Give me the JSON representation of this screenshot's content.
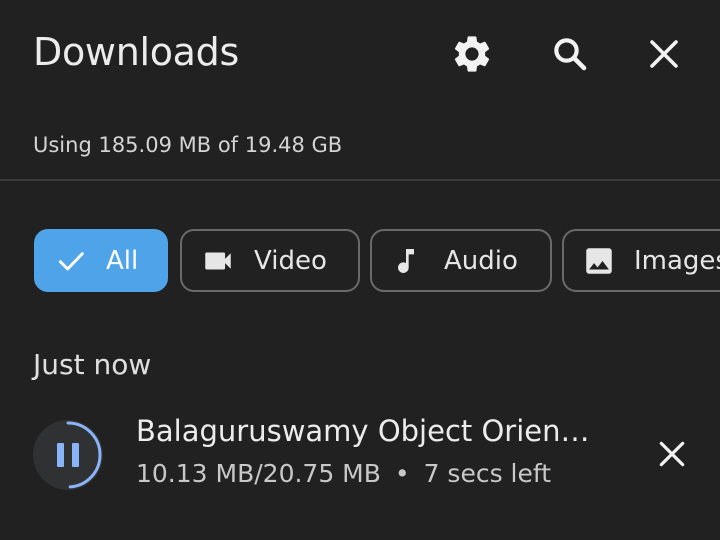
{
  "header": {
    "title": "Downloads",
    "settings_icon": "gear-icon",
    "search_icon": "search-icon",
    "close_icon": "close-icon"
  },
  "storage": {
    "text": "Using 185.09 MB of 19.48 GB"
  },
  "filters": [
    {
      "label": "All",
      "icon": "check-icon",
      "selected": true
    },
    {
      "label": "Video",
      "icon": "video-camera-icon",
      "selected": false
    },
    {
      "label": "Audio",
      "icon": "music-note-icon",
      "selected": false
    },
    {
      "label": "Images",
      "icon": "image-icon",
      "selected": false
    }
  ],
  "sections": [
    {
      "label": "Just now",
      "items": [
        {
          "name": "Balaguruswamy Object Orien…",
          "progress_text": "10.13 MB/20.75 MB",
          "separator": "•",
          "eta": "7 secs left",
          "progress_fraction": 0.488,
          "state_icon": "pause-icon",
          "cancel_icon": "close-icon"
        }
      ]
    }
  ],
  "colors": {
    "background": "#212121",
    "accent": "#4fa3e9",
    "progress_ring": "#8ab4f8",
    "chip_border": "#6a6a6a"
  }
}
